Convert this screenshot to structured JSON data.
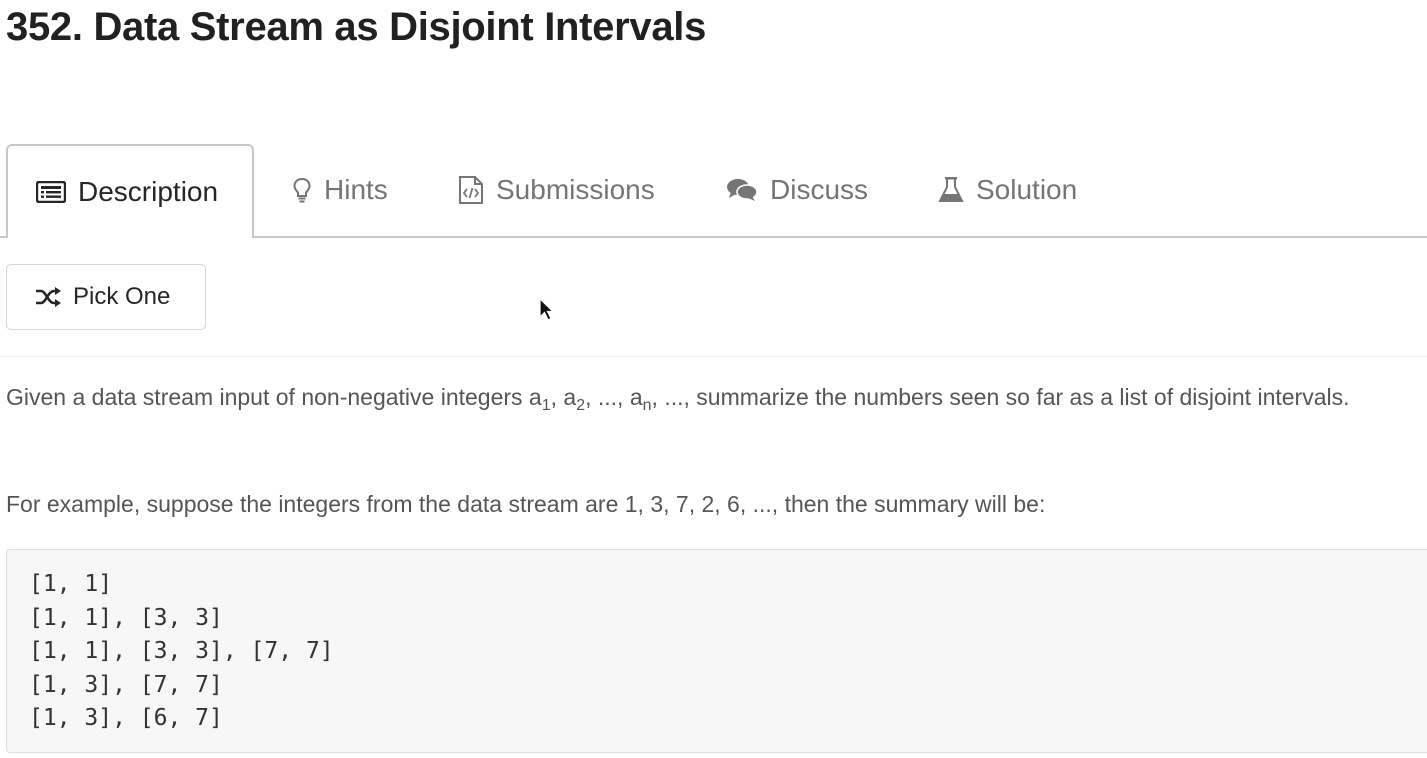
{
  "problem": {
    "title": "352. Data Stream as Disjoint Intervals"
  },
  "tabs": [
    {
      "label": "Description",
      "icon": "description-icon",
      "active": true
    },
    {
      "label": "Hints",
      "icon": "lightbulb-icon",
      "active": false
    },
    {
      "label": "Submissions",
      "icon": "code-file-icon",
      "active": false
    },
    {
      "label": "Discuss",
      "icon": "comments-icon",
      "active": false
    },
    {
      "label": "Solution",
      "icon": "flask-icon",
      "active": false
    }
  ],
  "pick_one": {
    "label": "Pick One",
    "icon": "shuffle-icon"
  },
  "description": {
    "p1_start": "Given a data stream input of non-negative integers a",
    "sub1": "1",
    "sep1": ", a",
    "sub2": "2",
    "sep2": ", ..., a",
    "subn": "n",
    "p1_end": ", ..., summarize the numbers seen so far as a list of disjoint intervals.",
    "p2": "For example, suppose the integers from the data stream are 1, 3, 7, 2, 6, ..., then the summary will be:"
  },
  "example_code": [
    "[1, 1]",
    "[1, 1], [3, 3]",
    "[1, 1], [3, 3], [7, 7]",
    "[1, 3], [7, 7]",
    "[1, 3], [6, 7]"
  ],
  "colors": {
    "active_text": "#262626",
    "inactive_text": "#757575",
    "code_background": "#f7f7f7",
    "border": "#c8c8c8"
  }
}
